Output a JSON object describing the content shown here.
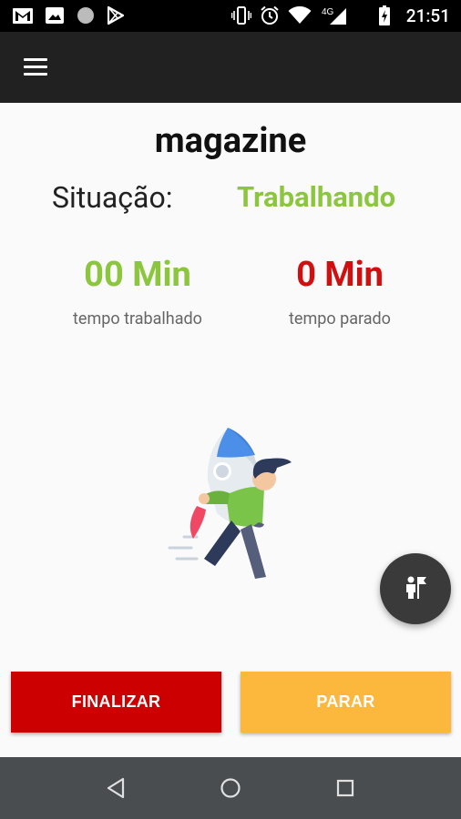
{
  "status_bar": {
    "time": "21:51",
    "network": "4G",
    "icons": [
      "gmail-icon",
      "image-icon",
      "circle-icon",
      "play-store-icon",
      "vibrate-icon",
      "alarm-icon",
      "wifi-icon",
      "signal-icon",
      "battery-icon"
    ]
  },
  "toolbar": {
    "menu_icon": "hamburger-menu-icon"
  },
  "main": {
    "title": "magazine",
    "situation_label": "Situação:",
    "situation_value": "Trabalhando",
    "worked_value": "00 Min",
    "worked_caption": "tempo trabalhado",
    "stopped_value": "0 Min",
    "stopped_caption": "tempo parado"
  },
  "colors": {
    "worked": "#8cc63f",
    "stopped": "#d01010",
    "finalizar": "#cc0000",
    "parar": "#fbb83c",
    "toolbar": "#212121"
  },
  "fab": {
    "icon": "person-flag-icon"
  },
  "buttons": {
    "finalizar_label": "FINALIZAR",
    "parar_label": "PARAR"
  },
  "nav": {
    "back_icon": "back-triangle-icon",
    "home_icon": "home-circle-icon",
    "recents_icon": "recents-square-icon"
  }
}
